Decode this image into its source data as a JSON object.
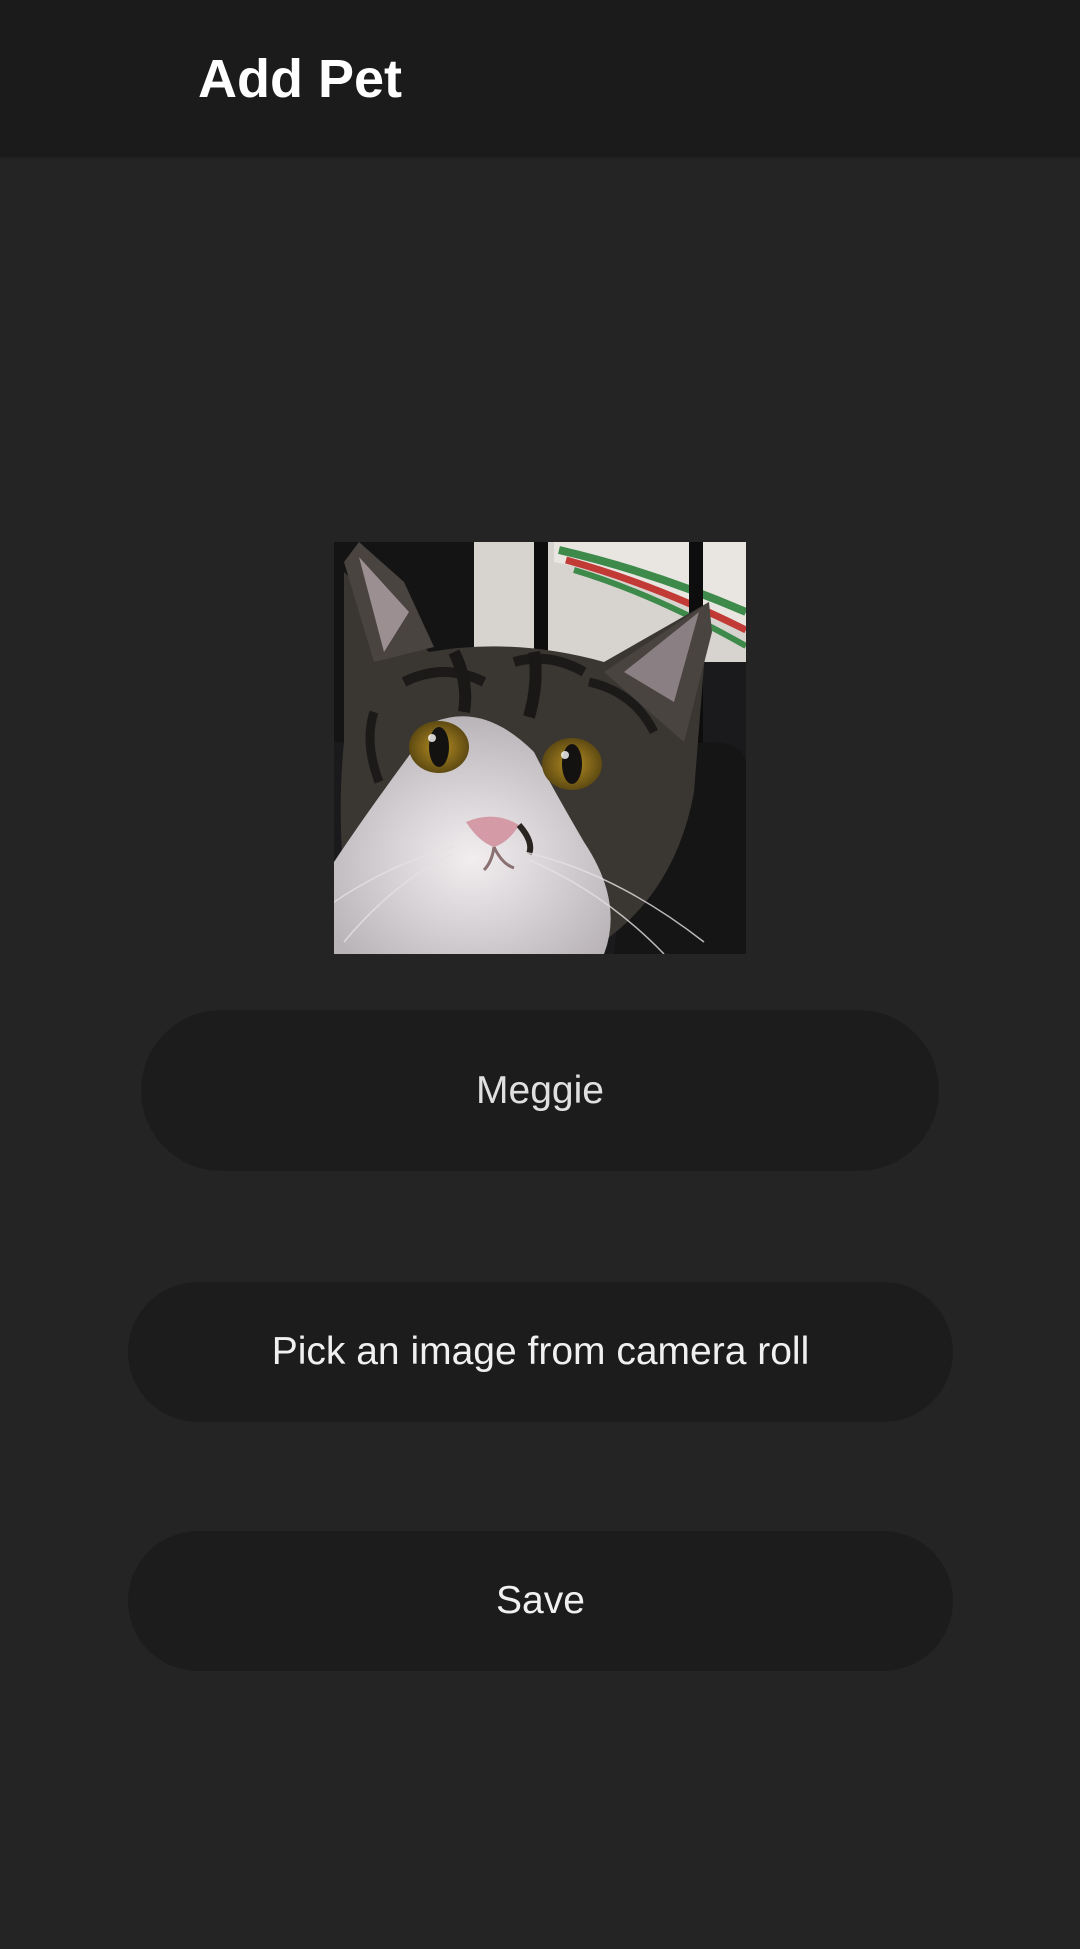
{
  "header": {
    "title": "Add Pet"
  },
  "pet_photo": {
    "subject": "cat-photo",
    "alt": "Pet photo"
  },
  "form": {
    "name_value": "Meggie",
    "pick_image_label": "Pick an image from camera roll",
    "save_label": "Save"
  },
  "colors": {
    "background": "#242424",
    "header_background": "#1b1b1b",
    "control_background": "#1c1c1c",
    "text": "#ffffff"
  }
}
